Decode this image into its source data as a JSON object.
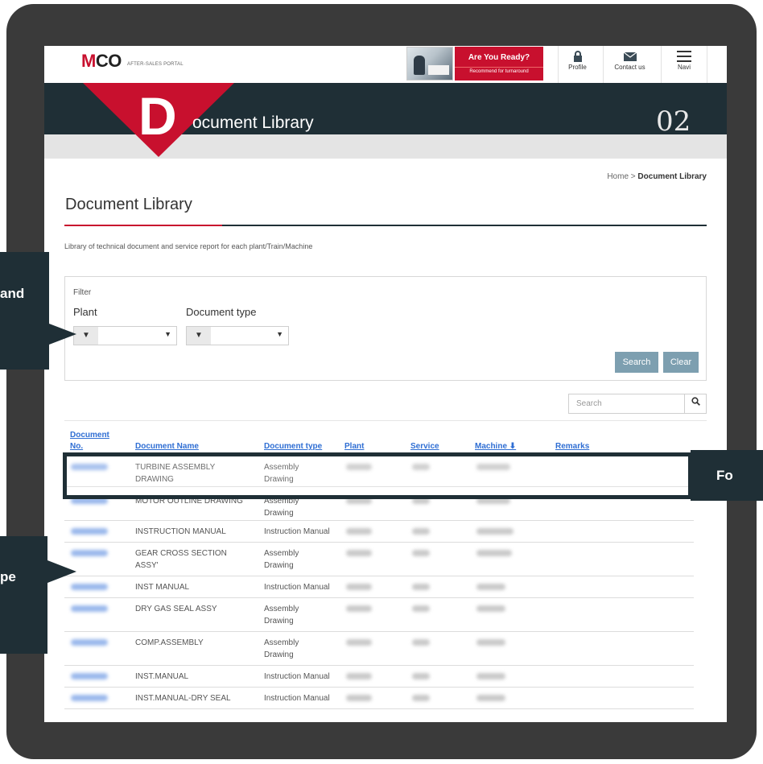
{
  "topbar": {
    "logo_text": "CO",
    "logo_mark": "M",
    "logo_sub": "AFTER-SALES PORTAL",
    "ad_title": "Are You Ready?",
    "ad_sub": "Recommend for turnaround",
    "nav": [
      {
        "label": "Profile",
        "icon": "lock-icon"
      },
      {
        "label": "Contact us",
        "icon": "mail-icon"
      },
      {
        "label": "Navi",
        "icon": "menu-icon"
      }
    ]
  },
  "header": {
    "big_letter": "D",
    "title_rest": "ocument Library",
    "number": "02"
  },
  "breadcrumb": {
    "home": "Home",
    "separator": " > ",
    "current": "Document Library"
  },
  "page": {
    "title": "Document Library",
    "description": "Library of technical document and service report for each plant/Train/Machine"
  },
  "filter": {
    "heading": "Filter",
    "plant_label": "Plant",
    "doctype_label": "Document type",
    "filter_icon": "▼",
    "dropdown_arrow": "▼",
    "search_label": "Search",
    "clear_label": "Clear"
  },
  "search": {
    "placeholder": "Search",
    "icon": "🔍"
  },
  "table": {
    "headers": {
      "doc_no_1": "Document",
      "doc_no_2": "No.",
      "name": "Document Name",
      "type": "Document type",
      "plant": "Plant",
      "service": "Service",
      "machine": "Machine ⬇",
      "remarks": "Remarks"
    },
    "rows": [
      {
        "name_1": "TURBINE ASSEMBLY",
        "name_2": "DRAWING",
        "type_1": "Assembly",
        "type_2": "Drawing"
      },
      {
        "name_1": "MOTOR OUTLINE DRAWING",
        "name_2": "",
        "type_1": "Assembly",
        "type_2": "Drawing"
      },
      {
        "name_1": "INSTRUCTION MANUAL",
        "name_2": "",
        "type_1": "Instruction Manual",
        "type_2": ""
      },
      {
        "name_1": "GEAR CROSS SECTION",
        "name_2": "ASSY'",
        "type_1": "Assembly",
        "type_2": "Drawing"
      },
      {
        "name_1": "INST MANUAL",
        "name_2": "",
        "type_1": "Instruction Manual",
        "type_2": ""
      },
      {
        "name_1": "DRY GAS SEAL ASSY",
        "name_2": "",
        "type_1": "Assembly",
        "type_2": "Drawing"
      },
      {
        "name_1": "COMP.ASSEMBLY",
        "name_2": "",
        "type_1": "Assembly",
        "type_2": "Drawing"
      },
      {
        "name_1": "INST.MANUAL",
        "name_2": "",
        "type_1": "Instruction Manual",
        "type_2": ""
      },
      {
        "name_1": "INST.MANUAL-DRY SEAL",
        "name_2": "",
        "type_1": "Instruction Manual",
        "type_2": ""
      }
    ]
  },
  "callouts": {
    "left_top": "and",
    "left_bottom": "pe",
    "right": "Fo"
  },
  "colors": {
    "brand_red": "#c8102e",
    "dark_navy": "#1f2f36",
    "link_blue": "#2f6ed3",
    "button_blue": "#7d9fb0"
  }
}
